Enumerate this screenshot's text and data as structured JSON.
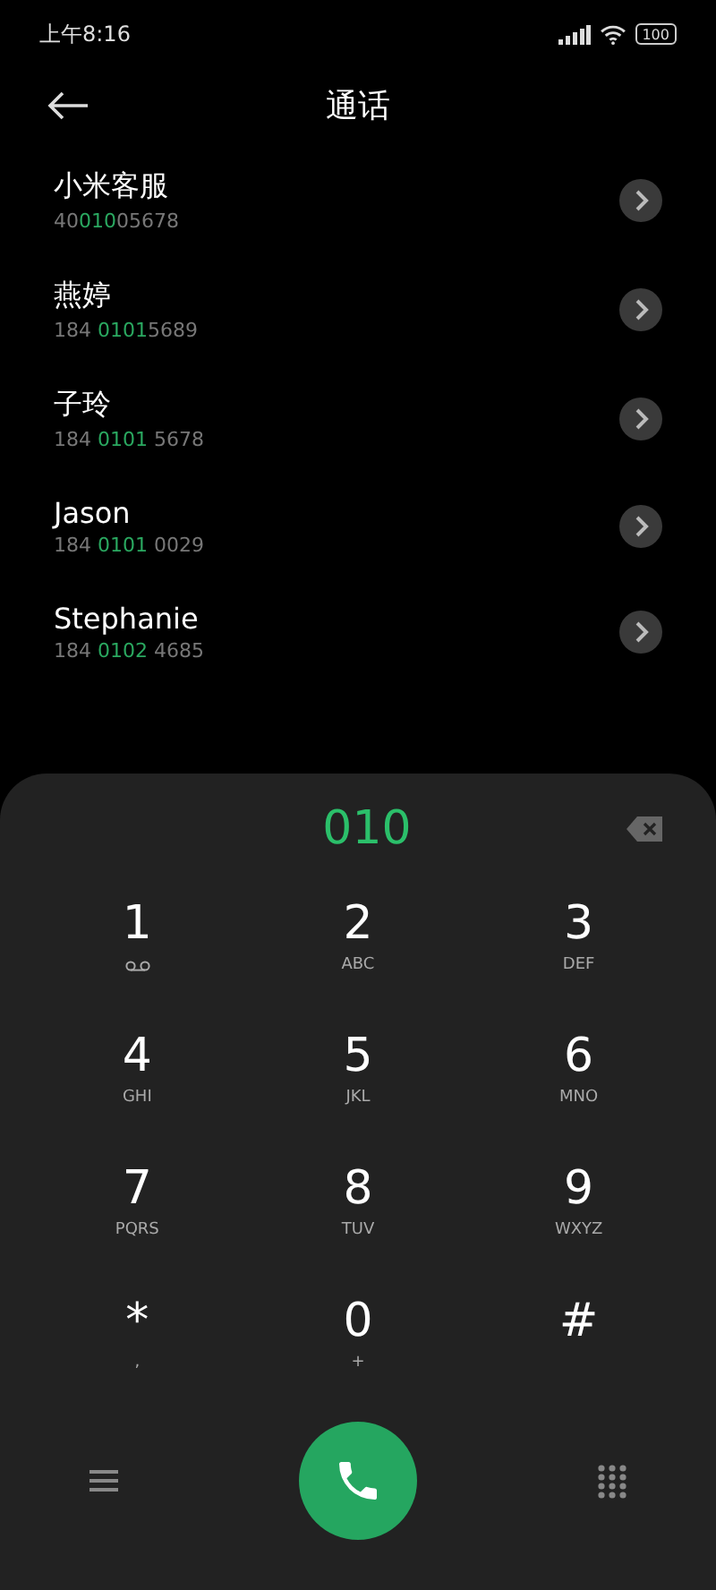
{
  "status_bar": {
    "time": "上午8:16",
    "battery": "100"
  },
  "header": {
    "title": "通话"
  },
  "contacts": [
    {
      "name": "小米客服",
      "before": "40",
      "match": "010",
      "after": "05678"
    },
    {
      "name": "燕婷",
      "before": "184 ",
      "match": "0101",
      "after": "5689"
    },
    {
      "name": "子玲",
      "before": "184 ",
      "match": "0101",
      "after": " 5678"
    },
    {
      "name": "Jason",
      "before": "184 ",
      "match": "0101",
      "after": " 0029"
    },
    {
      "name": "Stephanie",
      "before": "184 ",
      "match": "0102",
      "after": " 4685"
    }
  ],
  "dialer": {
    "entered": "010",
    "keys": [
      {
        "digit": "1",
        "kind": "voicemail"
      },
      {
        "digit": "2",
        "kind": "letters",
        "sub": "ABC"
      },
      {
        "digit": "3",
        "kind": "letters",
        "sub": "DEF"
      },
      {
        "digit": "4",
        "kind": "letters",
        "sub": "GHI"
      },
      {
        "digit": "5",
        "kind": "letters",
        "sub": "JKL"
      },
      {
        "digit": "6",
        "kind": "letters",
        "sub": "MNO"
      },
      {
        "digit": "7",
        "kind": "letters",
        "sub": "PQRS"
      },
      {
        "digit": "8",
        "kind": "letters",
        "sub": "TUV"
      },
      {
        "digit": "9",
        "kind": "letters",
        "sub": "WXYZ"
      },
      {
        "digit": "*",
        "kind": "letters",
        "sub": ","
      },
      {
        "digit": "0",
        "kind": "letters",
        "sub": "+"
      },
      {
        "digit": "#",
        "kind": "plain"
      }
    ]
  }
}
